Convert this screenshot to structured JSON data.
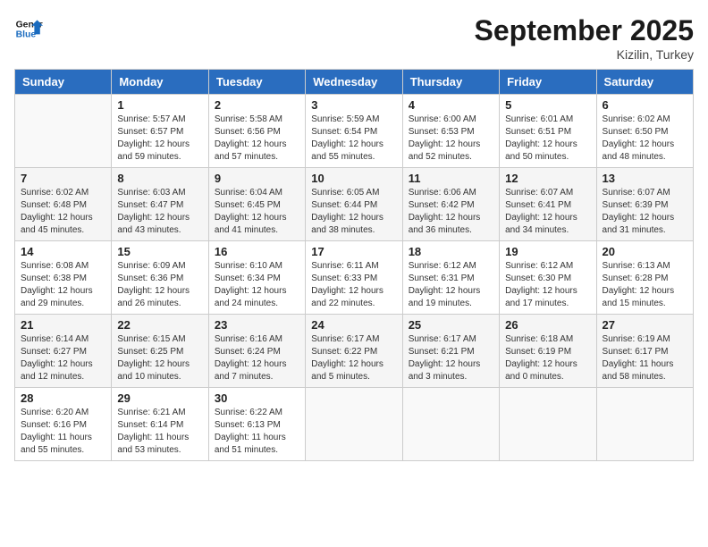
{
  "header": {
    "logo_line1": "General",
    "logo_line2": "Blue",
    "month": "September 2025",
    "location": "Kizilin, Turkey"
  },
  "weekdays": [
    "Sunday",
    "Monday",
    "Tuesday",
    "Wednesday",
    "Thursday",
    "Friday",
    "Saturday"
  ],
  "weeks": [
    [
      {
        "day": "",
        "info": ""
      },
      {
        "day": "1",
        "info": "Sunrise: 5:57 AM\nSunset: 6:57 PM\nDaylight: 12 hours\nand 59 minutes."
      },
      {
        "day": "2",
        "info": "Sunrise: 5:58 AM\nSunset: 6:56 PM\nDaylight: 12 hours\nand 57 minutes."
      },
      {
        "day": "3",
        "info": "Sunrise: 5:59 AM\nSunset: 6:54 PM\nDaylight: 12 hours\nand 55 minutes."
      },
      {
        "day": "4",
        "info": "Sunrise: 6:00 AM\nSunset: 6:53 PM\nDaylight: 12 hours\nand 52 minutes."
      },
      {
        "day": "5",
        "info": "Sunrise: 6:01 AM\nSunset: 6:51 PM\nDaylight: 12 hours\nand 50 minutes."
      },
      {
        "day": "6",
        "info": "Sunrise: 6:02 AM\nSunset: 6:50 PM\nDaylight: 12 hours\nand 48 minutes."
      }
    ],
    [
      {
        "day": "7",
        "info": "Sunrise: 6:02 AM\nSunset: 6:48 PM\nDaylight: 12 hours\nand 45 minutes."
      },
      {
        "day": "8",
        "info": "Sunrise: 6:03 AM\nSunset: 6:47 PM\nDaylight: 12 hours\nand 43 minutes."
      },
      {
        "day": "9",
        "info": "Sunrise: 6:04 AM\nSunset: 6:45 PM\nDaylight: 12 hours\nand 41 minutes."
      },
      {
        "day": "10",
        "info": "Sunrise: 6:05 AM\nSunset: 6:44 PM\nDaylight: 12 hours\nand 38 minutes."
      },
      {
        "day": "11",
        "info": "Sunrise: 6:06 AM\nSunset: 6:42 PM\nDaylight: 12 hours\nand 36 minutes."
      },
      {
        "day": "12",
        "info": "Sunrise: 6:07 AM\nSunset: 6:41 PM\nDaylight: 12 hours\nand 34 minutes."
      },
      {
        "day": "13",
        "info": "Sunrise: 6:07 AM\nSunset: 6:39 PM\nDaylight: 12 hours\nand 31 minutes."
      }
    ],
    [
      {
        "day": "14",
        "info": "Sunrise: 6:08 AM\nSunset: 6:38 PM\nDaylight: 12 hours\nand 29 minutes."
      },
      {
        "day": "15",
        "info": "Sunrise: 6:09 AM\nSunset: 6:36 PM\nDaylight: 12 hours\nand 26 minutes."
      },
      {
        "day": "16",
        "info": "Sunrise: 6:10 AM\nSunset: 6:34 PM\nDaylight: 12 hours\nand 24 minutes."
      },
      {
        "day": "17",
        "info": "Sunrise: 6:11 AM\nSunset: 6:33 PM\nDaylight: 12 hours\nand 22 minutes."
      },
      {
        "day": "18",
        "info": "Sunrise: 6:12 AM\nSunset: 6:31 PM\nDaylight: 12 hours\nand 19 minutes."
      },
      {
        "day": "19",
        "info": "Sunrise: 6:12 AM\nSunset: 6:30 PM\nDaylight: 12 hours\nand 17 minutes."
      },
      {
        "day": "20",
        "info": "Sunrise: 6:13 AM\nSunset: 6:28 PM\nDaylight: 12 hours\nand 15 minutes."
      }
    ],
    [
      {
        "day": "21",
        "info": "Sunrise: 6:14 AM\nSunset: 6:27 PM\nDaylight: 12 hours\nand 12 minutes."
      },
      {
        "day": "22",
        "info": "Sunrise: 6:15 AM\nSunset: 6:25 PM\nDaylight: 12 hours\nand 10 minutes."
      },
      {
        "day": "23",
        "info": "Sunrise: 6:16 AM\nSunset: 6:24 PM\nDaylight: 12 hours\nand 7 minutes."
      },
      {
        "day": "24",
        "info": "Sunrise: 6:17 AM\nSunset: 6:22 PM\nDaylight: 12 hours\nand 5 minutes."
      },
      {
        "day": "25",
        "info": "Sunrise: 6:17 AM\nSunset: 6:21 PM\nDaylight: 12 hours\nand 3 minutes."
      },
      {
        "day": "26",
        "info": "Sunrise: 6:18 AM\nSunset: 6:19 PM\nDaylight: 12 hours\nand 0 minutes."
      },
      {
        "day": "27",
        "info": "Sunrise: 6:19 AM\nSunset: 6:17 PM\nDaylight: 11 hours\nand 58 minutes."
      }
    ],
    [
      {
        "day": "28",
        "info": "Sunrise: 6:20 AM\nSunset: 6:16 PM\nDaylight: 11 hours\nand 55 minutes."
      },
      {
        "day": "29",
        "info": "Sunrise: 6:21 AM\nSunset: 6:14 PM\nDaylight: 11 hours\nand 53 minutes."
      },
      {
        "day": "30",
        "info": "Sunrise: 6:22 AM\nSunset: 6:13 PM\nDaylight: 11 hours\nand 51 minutes."
      },
      {
        "day": "",
        "info": ""
      },
      {
        "day": "",
        "info": ""
      },
      {
        "day": "",
        "info": ""
      },
      {
        "day": "",
        "info": ""
      }
    ]
  ]
}
